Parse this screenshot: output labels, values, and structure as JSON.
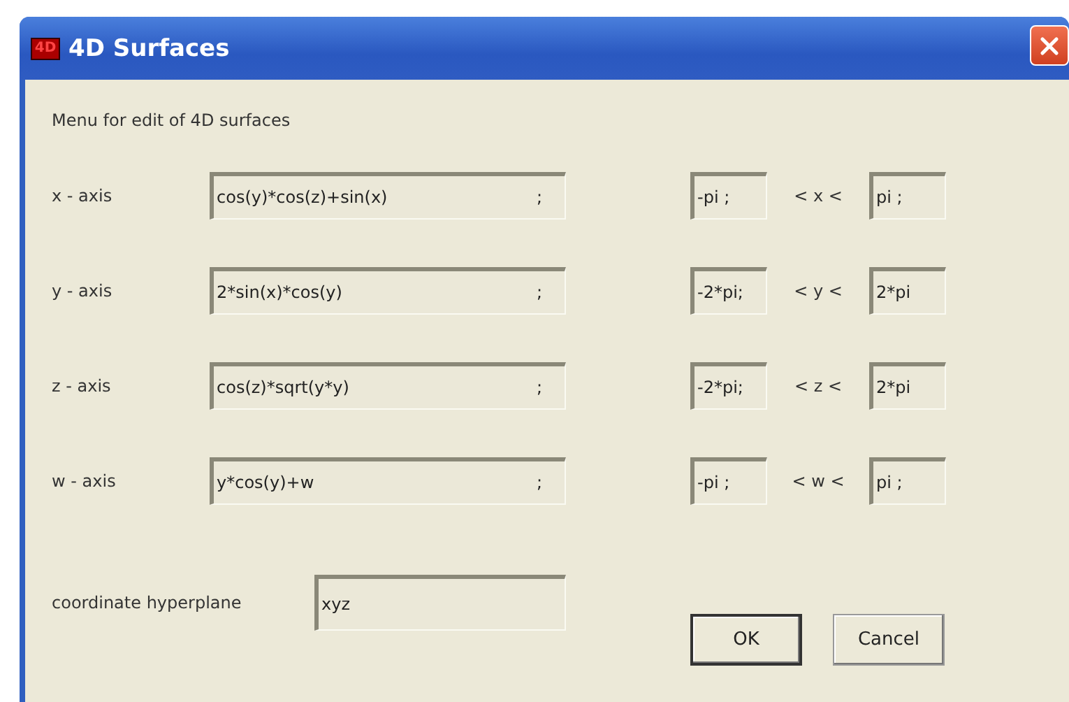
{
  "window": {
    "title": "4D Surfaces",
    "icon_text": "4D"
  },
  "heading": "Menu for edit of 4D surfaces",
  "axes": [
    {
      "label": "x - axis",
      "formula": "cos(y)*cos(z)+sin(x)",
      "formula_suffix": ";",
      "min": "-pi ;",
      "relation": "< x <",
      "max": "pi ;"
    },
    {
      "label": "y - axis",
      "formula": "2*sin(x)*cos(y)",
      "formula_suffix": ";",
      "min": "-2*pi;",
      "relation": "< y <",
      "max": "2*pi"
    },
    {
      "label": "z - axis",
      "formula": "cos(z)*sqrt(y*y)",
      "formula_suffix": ";",
      "min": "-2*pi;",
      "relation": "< z <",
      "max": "2*pi"
    },
    {
      "label": "w - axis",
      "formula": "y*cos(y)+w",
      "formula_suffix": ";",
      "min": "-pi ;",
      "relation": "< w <",
      "max": "pi ;"
    }
  ],
  "hyperplane": {
    "label": "coordinate hyperplane",
    "value": "xyz"
  },
  "buttons": [
    {
      "label": "OK",
      "default": true
    },
    {
      "label": "Cancel",
      "default": false
    }
  ]
}
